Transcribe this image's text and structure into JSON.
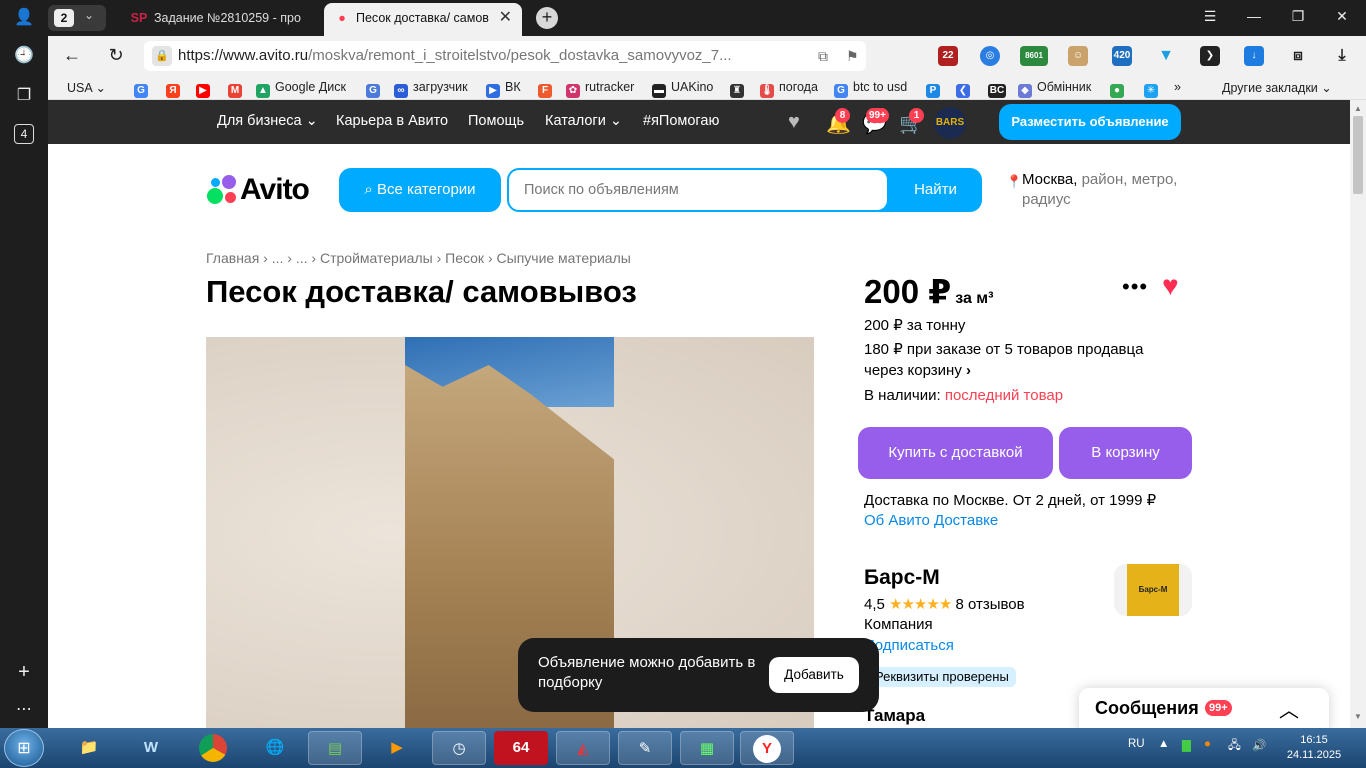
{
  "browser": {
    "tab_count": "2",
    "tabs": [
      {
        "icon": "SP",
        "label": "Задание №2810259 - про"
      },
      {
        "icon": "●",
        "label": "Песок доставка/ самов"
      }
    ],
    "url_host": "https://www.avito.ru",
    "url_path": "/moskva/remont_i_stroitelstvo/pesok_dostavka_samovyvoz_7...",
    "rail_tab_count": "4"
  },
  "bookmarks": [
    {
      "label": "USA",
      "icon": "",
      "color": "#f1f1f1"
    },
    {
      "label": "",
      "icon": "G",
      "color": "#4285f4"
    },
    {
      "label": "",
      "icon": "Я",
      "color": "#fc3f1d"
    },
    {
      "label": "",
      "icon": "▶",
      "color": "#ff0000"
    },
    {
      "label": "",
      "icon": "M",
      "color": "#ea4335"
    },
    {
      "label": "Google Диск",
      "icon": "▲",
      "color": "#1fa463"
    },
    {
      "label": "",
      "icon": "G",
      "color": "#4a7bd8"
    },
    {
      "label": "загрузчик",
      "icon": "∞",
      "color": "#2b5dd8"
    },
    {
      "label": "ВК",
      "icon": "▶",
      "color": "#2f6ee0"
    },
    {
      "label": "",
      "icon": "F",
      "color": "#ee5a2d"
    },
    {
      "label": "rutracker",
      "icon": "✿",
      "color": "#d0346c"
    },
    {
      "label": "UAKino",
      "icon": "▬",
      "color": "#222222"
    },
    {
      "label": "",
      "icon": "♜",
      "color": "#333333"
    },
    {
      "label": "погода",
      "icon": "🌡",
      "color": "#e44b4b"
    },
    {
      "label": "btc to usd",
      "icon": "G",
      "color": "#4285f4"
    },
    {
      "label": "",
      "icon": "P",
      "color": "#1e88e5"
    },
    {
      "label": "",
      "icon": "❮",
      "color": "#3d6de6"
    },
    {
      "label": "",
      "icon": "BC",
      "color": "#222222"
    },
    {
      "label": "Обмінник",
      "icon": "◆",
      "color": "#6b7bd6"
    },
    {
      "label": "",
      "icon": "●",
      "color": "#34a853"
    },
    {
      "label": "",
      "icon": "✳",
      "color": "#1da1f2"
    }
  ],
  "bookmarks_more": "»",
  "other_bookmarks": "Другие закладки",
  "topnav": {
    "business": "Для бизнеса",
    "career": "Карьера в Авито",
    "help": "Помощь",
    "catalogs": "Каталоги",
    "ipomogayu": "#яПомогаю",
    "notif_badge": "8",
    "messages_badge": "99+",
    "cart_badge": "1",
    "post_button": "Разместить объявление"
  },
  "header": {
    "logo": "Avito",
    "categories_button": "Все категории",
    "search_placeholder": "Поиск по объявлениям",
    "search_button": "Найти",
    "location_city": "Москва,",
    "location_rest": "район, метро,",
    "location_rest2": "радиус"
  },
  "breadcrumbs": [
    "Главная",
    "...",
    "...",
    "Стройматериалы",
    "Песок",
    "Сыпучие материалы"
  ],
  "listing": {
    "title": "Песок доставка/ самовывоз",
    "price": "200 ₽",
    "price_unit": "за м³",
    "price_ton": "200 ₽ за тонну",
    "bulk_line1": "180 ₽ при заказе от 5 товаров продавца",
    "bulk_line2": "через корзину",
    "stock_label": "В наличии:",
    "stock_value": "последний товар",
    "buy_button": "Купить с доставкой",
    "cart_button": "В корзину",
    "delivery_text": "Доставка по Москве. От 2 дней, от 1999 ₽",
    "delivery_link": "Об Авито Доставке"
  },
  "seller": {
    "name": "Барс-М",
    "rating": "4,5",
    "rating_stars": 4.5,
    "reviews": "8 отзывов",
    "type": "Компания",
    "subscribe": "Подписаться",
    "verified": "Реквизиты проверены",
    "contact": "Тамара",
    "logo_text": "Барс-М"
  },
  "toast": {
    "message": "Объявление можно добавить в подборку",
    "button": "Добавить"
  },
  "messages_panel": {
    "title": "Сообщения",
    "badge": "99+"
  },
  "taskbar": {
    "lang": "RU",
    "time": "16:15",
    "date": "24.11.2025",
    "apps": [
      "explorer",
      "wise-care",
      "chrome",
      "browser-globe",
      "utility",
      "media-player",
      "clock-app",
      "64-app",
      "chart-app",
      "notes-app",
      "terminal-app",
      "yandex-browser"
    ]
  },
  "colors": {
    "avito_blue": "#00aaff",
    "avito_purple": "#965eeb",
    "avito_red": "#ff4053"
  }
}
